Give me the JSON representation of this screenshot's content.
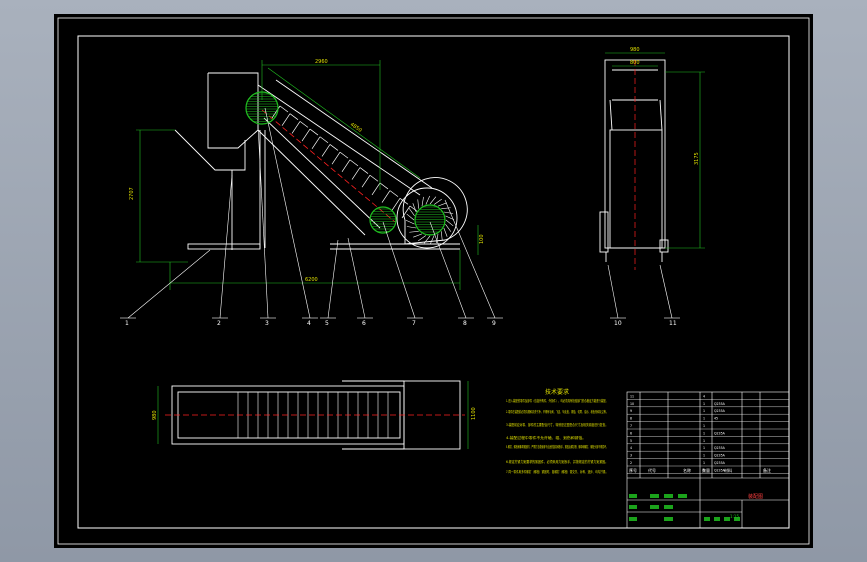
{
  "drawing": {
    "background_color": "#000000",
    "line_color": "#ffffff",
    "accent_red": "#ff2020",
    "accent_green": "#20c020",
    "accent_yellow": "#e0e000"
  },
  "dimensions": {
    "top_width": "2960",
    "left_height": "2707",
    "belt_length": "4850",
    "overall_length": "6200",
    "right_height": "100",
    "side_top_outer": "980",
    "side_top_inner": "800",
    "side_height": "3175",
    "plan_width_left": "980",
    "plan_width_right": "1100"
  },
  "balloons": [
    "1",
    "2",
    "3",
    "4",
    "5",
    "6",
    "7",
    "8",
    "9",
    "10",
    "11"
  ],
  "tech_requirements": {
    "title": "技术要求",
    "lines": [
      "1.进入装配的零件及部件（包括外购件、外协件），均必须具有检验部门的合格证方能进行装配。",
      "2.零件在装配前必须清理和清洗干净，不得有毛刺、飞边、氧化皮、锈蚀、切屑、油污、着色剂和灰尘等。",
      "3.装配前应对零、部件的主要配合尺寸，特别是过盈配合尺寸及相关精度进行复查。",
      "4.装配过程中零件不允许磕、碰、划伤和锈蚀。",
      "5.螺钉、螺栓和螺母紧固时，严禁打击或使用不合适的旋具和扳手。紧固后螺钉槽、螺母和螺钉、螺栓头部不得损坏。",
      "6.规定拧紧力矩要求的紧固件，必须采用力矩扳手，并按规定的拧紧力矩紧固。",
      "7.同一零件用多件螺钉（螺栓）紧固时，各螺钉（螺栓）需交叉、对称、逐步、均匀拧紧。"
    ]
  },
  "title_block": {
    "rows": [
      {
        "no": "11",
        "name": "",
        "qty": "4",
        "material": ""
      },
      {
        "no": "10",
        "name": "",
        "qty": "1",
        "material": "Q235A"
      },
      {
        "no": "9",
        "name": "",
        "qty": "1",
        "material": "Q235A"
      },
      {
        "no": "8",
        "name": "",
        "qty": "1",
        "material": "45"
      },
      {
        "no": "7",
        "name": "",
        "qty": "1",
        "material": ""
      },
      {
        "no": "6",
        "name": "",
        "qty": "1",
        "material": "Q235A"
      },
      {
        "no": "5",
        "name": "",
        "qty": "1",
        "material": ""
      },
      {
        "no": "4",
        "name": "",
        "qty": "1",
        "material": "Q235A"
      },
      {
        "no": "3",
        "name": "",
        "qty": "1",
        "material": "Q235A"
      },
      {
        "no": "2",
        "name": "",
        "qty": "1",
        "material": "Q235A"
      },
      {
        "no": "1",
        "name": "",
        "qty": "1",
        "material": "Q235A"
      }
    ],
    "header": {
      "no": "序号",
      "code": "代号",
      "name": "名称",
      "qty": "数量",
      "material": "材料",
      "remark": "备注"
    },
    "drawing_name": "装配图",
    "scale": "1:15"
  }
}
